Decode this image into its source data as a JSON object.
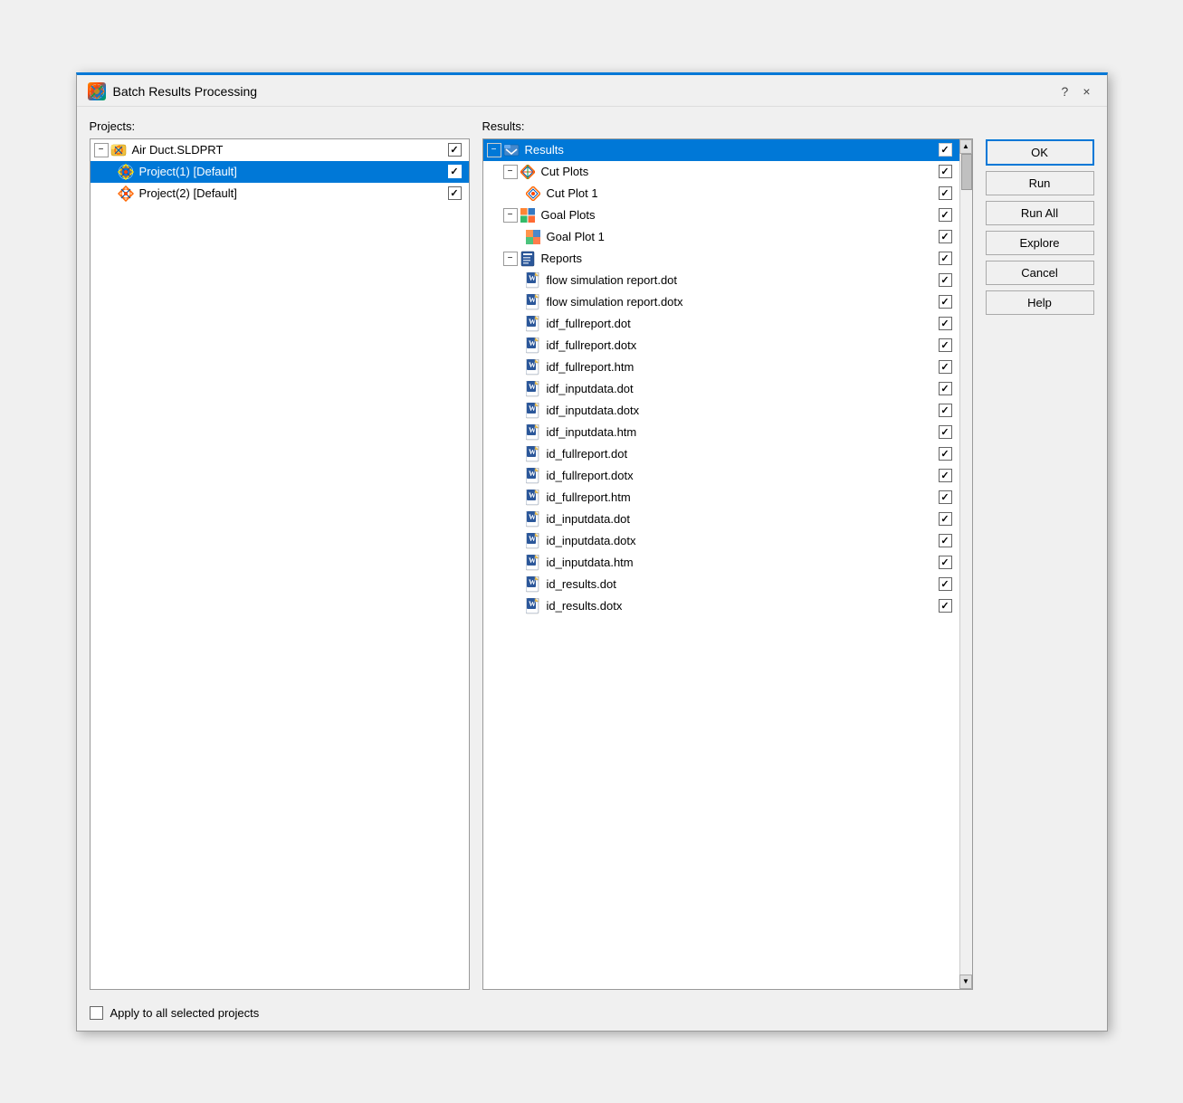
{
  "dialog": {
    "title": "Batch Results Processing",
    "help_label": "?",
    "close_label": "×"
  },
  "projects_label": "Projects:",
  "results_label": "Results:",
  "projects": [
    {
      "id": "air-duct",
      "label": "Air Duct.SLDPRT",
      "level": 0,
      "expanded": true,
      "checked": true,
      "selected": false,
      "icon": "folder-project"
    },
    {
      "id": "project1",
      "label": "Project(1) [Default]",
      "level": 1,
      "checked": true,
      "selected": true,
      "icon": "project"
    },
    {
      "id": "project2",
      "label": "Project(2) [Default]",
      "level": 1,
      "checked": true,
      "selected": false,
      "icon": "project"
    }
  ],
  "results_tree": [
    {
      "id": "results-root",
      "label": "Results",
      "level": 0,
      "expanded": true,
      "checked": true,
      "selected": true,
      "icon": "results"
    },
    {
      "id": "cut-plots",
      "label": "Cut Plots",
      "level": 1,
      "expanded": true,
      "checked": true,
      "selected": false,
      "icon": "cut-plots"
    },
    {
      "id": "cut-plot-1",
      "label": "Cut Plot 1",
      "level": 2,
      "checked": true,
      "selected": false,
      "icon": "cut-plot-item"
    },
    {
      "id": "goal-plots",
      "label": "Goal Plots",
      "level": 1,
      "expanded": true,
      "checked": true,
      "selected": false,
      "icon": "goal-plots"
    },
    {
      "id": "goal-plot-1",
      "label": "Goal Plot 1",
      "level": 2,
      "checked": true,
      "selected": false,
      "icon": "goal-plot-item"
    },
    {
      "id": "reports",
      "label": "Reports",
      "level": 1,
      "expanded": true,
      "checked": true,
      "selected": false,
      "icon": "reports"
    },
    {
      "id": "r1",
      "label": "flow simulation report.dot",
      "level": 2,
      "checked": true,
      "selected": false,
      "icon": "word-doc"
    },
    {
      "id": "r2",
      "label": "flow simulation report.dotx",
      "level": 2,
      "checked": true,
      "selected": false,
      "icon": "word-doc"
    },
    {
      "id": "r3",
      "label": "idf_fullreport.dot",
      "level": 2,
      "checked": true,
      "selected": false,
      "icon": "word-doc"
    },
    {
      "id": "r4",
      "label": "idf_fullreport.dotx",
      "level": 2,
      "checked": true,
      "selected": false,
      "icon": "word-doc"
    },
    {
      "id": "r5",
      "label": "idf_fullreport.htm",
      "level": 2,
      "checked": true,
      "selected": false,
      "icon": "word-doc"
    },
    {
      "id": "r6",
      "label": "idf_inputdata.dot",
      "level": 2,
      "checked": true,
      "selected": false,
      "icon": "word-doc"
    },
    {
      "id": "r7",
      "label": "idf_inputdata.dotx",
      "level": 2,
      "checked": true,
      "selected": false,
      "icon": "word-doc"
    },
    {
      "id": "r8",
      "label": "idf_inputdata.htm",
      "level": 2,
      "checked": true,
      "selected": false,
      "icon": "word-doc"
    },
    {
      "id": "r9",
      "label": "id_fullreport.dot",
      "level": 2,
      "checked": true,
      "selected": false,
      "icon": "word-doc"
    },
    {
      "id": "r10",
      "label": "id_fullreport.dotx",
      "level": 2,
      "checked": true,
      "selected": false,
      "icon": "word-doc"
    },
    {
      "id": "r11",
      "label": "id_fullreport.htm",
      "level": 2,
      "checked": true,
      "selected": false,
      "icon": "word-doc"
    },
    {
      "id": "r12",
      "label": "id_inputdata.dot",
      "level": 2,
      "checked": true,
      "selected": false,
      "icon": "word-doc"
    },
    {
      "id": "r13",
      "label": "id_inputdata.dotx",
      "level": 2,
      "checked": true,
      "selected": false,
      "icon": "word-doc"
    },
    {
      "id": "r14",
      "label": "id_inputdata.htm",
      "level": 2,
      "checked": true,
      "selected": false,
      "icon": "word-doc"
    },
    {
      "id": "r15",
      "label": "id_results.dot",
      "level": 2,
      "checked": true,
      "selected": false,
      "icon": "word-doc"
    },
    {
      "id": "r16",
      "label": "id_results.dotx",
      "level": 2,
      "checked": true,
      "selected": false,
      "icon": "word-doc"
    }
  ],
  "buttons": {
    "ok": "OK",
    "run": "Run",
    "run_all": "Run All",
    "explore": "Explore",
    "cancel": "Cancel",
    "help": "Help"
  },
  "footer": {
    "checkbox_label": "Apply to all selected projects",
    "checked": false
  }
}
